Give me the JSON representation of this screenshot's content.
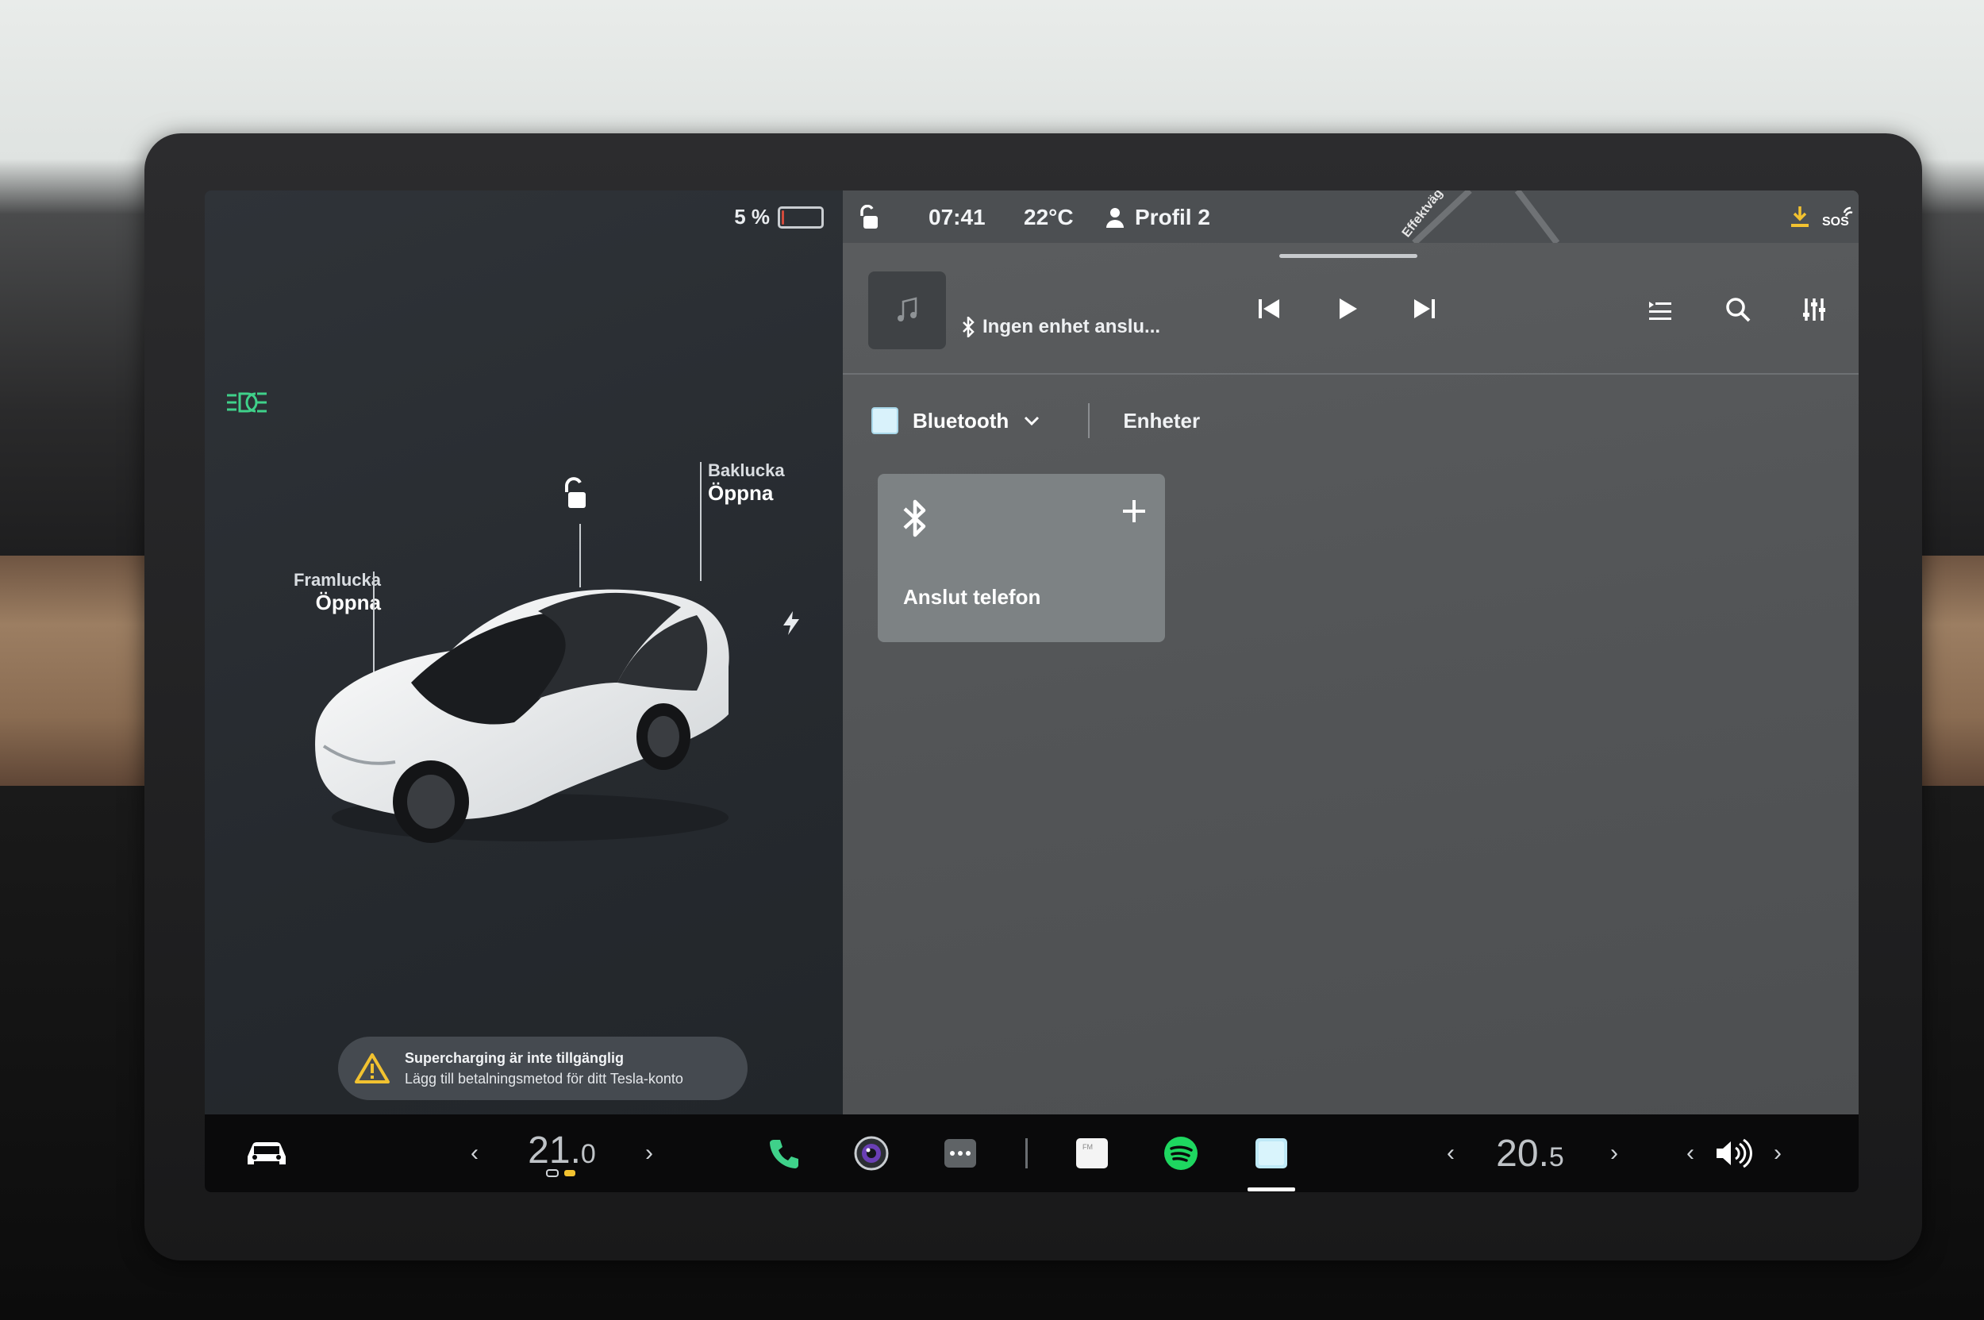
{
  "status": {
    "battery_percent": "5 %",
    "battery_level": 0.05,
    "time": "07:41",
    "outside_temp": "22°C",
    "profile": "Profil 2",
    "map_label": "Effektväg"
  },
  "car": {
    "front_trunk_label": "Framlucka",
    "front_trunk_action": "Öppna",
    "rear_trunk_label": "Baklucka",
    "rear_trunk_action": "Öppna"
  },
  "toast": {
    "line1": "Supercharging är inte tillgänglig",
    "line2": "Lägg till betalningsmetod för ditt Tesla-konto"
  },
  "player": {
    "source": "Ingen enhet anslu..."
  },
  "tabs": {
    "bluetooth": "Bluetooth",
    "devices": "Enheter"
  },
  "card": {
    "label": "Anslut telefon"
  },
  "climate": {
    "driver_temp_main": "21.",
    "driver_temp_dec": "0",
    "passenger_temp_main": "20.",
    "passenger_temp_dec": "5"
  },
  "colors": {
    "accent_green": "#3fd18a",
    "download_yellow": "#f2c230",
    "warning_toast_bg": "#454a50"
  },
  "icons": [
    "headlight-icon",
    "lock-icon",
    "charge-port-icon",
    "music-note-icon",
    "bluetooth-icon",
    "previous-icon",
    "play-icon",
    "next-icon",
    "queue-icon",
    "search-icon",
    "equalizer-icon",
    "plus-icon",
    "car-icon",
    "phone-icon",
    "camera-icon",
    "more-icon",
    "radio-icon",
    "spotify-icon",
    "bluetooth-app-icon",
    "volume-icon",
    "download-icon",
    "sos-icon",
    "person-icon",
    "warning-icon"
  ]
}
